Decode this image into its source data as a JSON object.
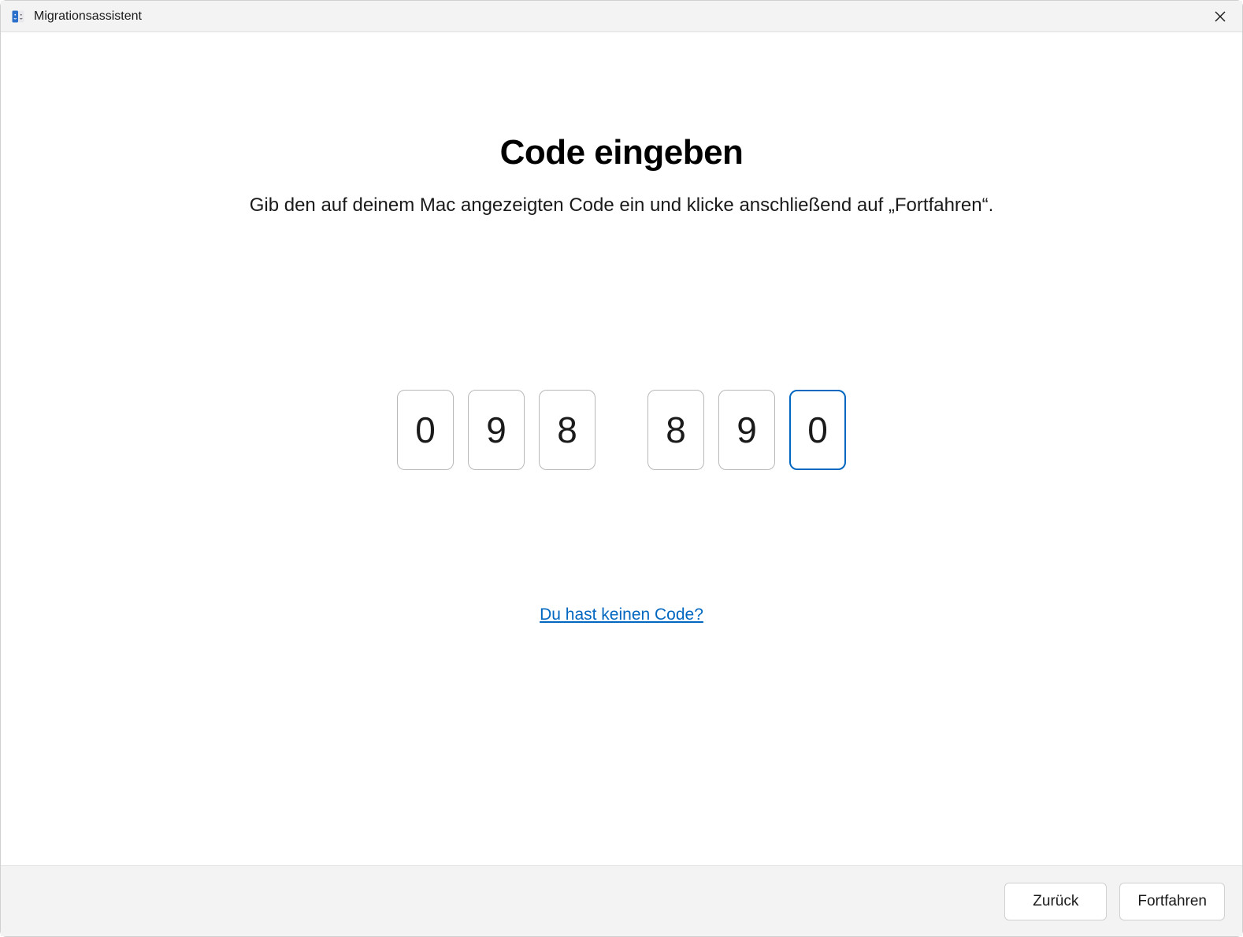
{
  "titlebar": {
    "app_title": "Migrationsassistent"
  },
  "main": {
    "heading": "Code eingeben",
    "subheading": "Gib den auf deinem Mac angezeigten Code ein und klicke anschließend auf „Fortfahren“.",
    "code_digits": [
      "0",
      "9",
      "8",
      "8",
      "9",
      "0"
    ],
    "focused_index": 5,
    "help_link": "Du hast keinen Code?"
  },
  "footer": {
    "back_label": "Zurück",
    "continue_label": "Fortfahren"
  }
}
